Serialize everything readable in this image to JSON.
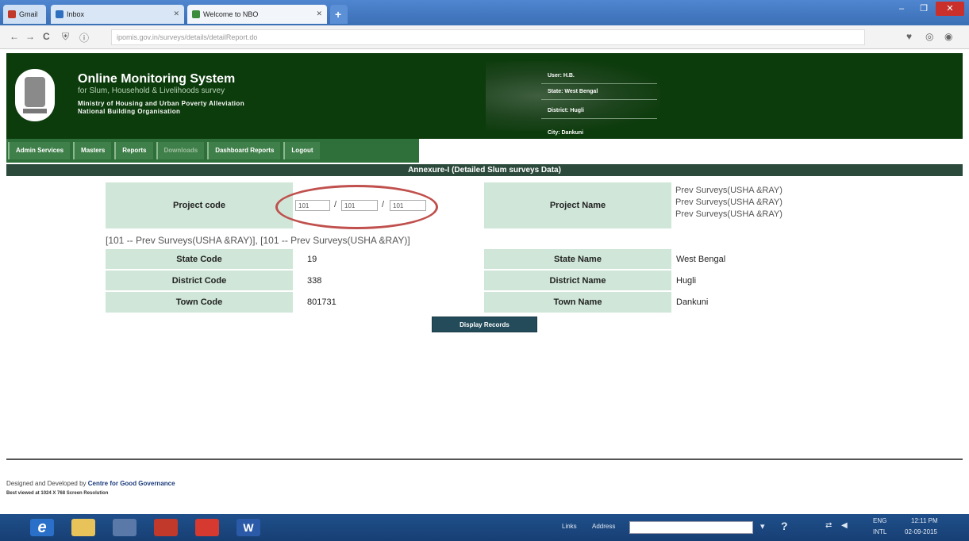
{
  "browser": {
    "tabs": [
      {
        "label": "Gmail"
      },
      {
        "label": "Inbox"
      },
      {
        "label": "Welcome to NBO"
      }
    ],
    "new_tab": "+",
    "url": "ipomis.gov.in/surveys/details/detailReport.do",
    "nav": {
      "back": "←",
      "forward": "→",
      "reload": "C"
    }
  },
  "header": {
    "title": "Online Monitoring System",
    "subtitle": "for Slum, Household & Livelihoods survey",
    "org_line1": "Ministry of Housing and Urban Poverty Alleviation",
    "org_line2": "National Building Organisation",
    "user_info": [
      "User: H.B.",
      "State: West Bengal",
      "District: Hugli",
      "City: Dankuni"
    ]
  },
  "menu": [
    {
      "label": "Admin Services",
      "muted": false
    },
    {
      "label": "Masters",
      "muted": false
    },
    {
      "label": "Reports",
      "muted": false
    },
    {
      "label": "Downloads",
      "muted": true
    },
    {
      "label": "Dashboard Reports",
      "muted": false
    },
    {
      "label": "Logout",
      "muted": false
    }
  ],
  "section_title": "Annexure-I (Detailed Slum surveys Data)",
  "form": {
    "project_code_label": "Project code",
    "project_code_values": [
      "101",
      "101",
      "101"
    ],
    "project_name_label": "Project Name",
    "project_names": [
      "Prev Surveys(USHA &RAY)",
      "Prev Surveys(USHA &RAY)",
      "Prev Surveys(USHA &RAY)"
    ],
    "summary": "[101 -- Prev Surveys(USHA &RAY)], [101 -- Prev Surveys(USHA &RAY)]",
    "rows": [
      {
        "label": "State Code",
        "value": "19",
        "name_label": "State Name",
        "name_value": "West Bengal"
      },
      {
        "label": "District Code",
        "value": "338",
        "name_label": "District Name",
        "name_value": "Hugli"
      },
      {
        "label": "Town Code",
        "value": "801731",
        "name_label": "Town Name",
        "name_value": "Dankuni"
      }
    ],
    "display_button": "Display Records"
  },
  "footer": {
    "designed_prefix": "Designed and Developed by",
    "designed_by": "Centre for Good Governance",
    "resolution_note": "Best viewed at 1024 X 768 Screen Resolution"
  },
  "taskbar": {
    "links_label": "Links",
    "address_label": "Address",
    "lang": "ENG",
    "region": "INTL",
    "time": "12:11 PM",
    "date": "02-09-2015"
  }
}
